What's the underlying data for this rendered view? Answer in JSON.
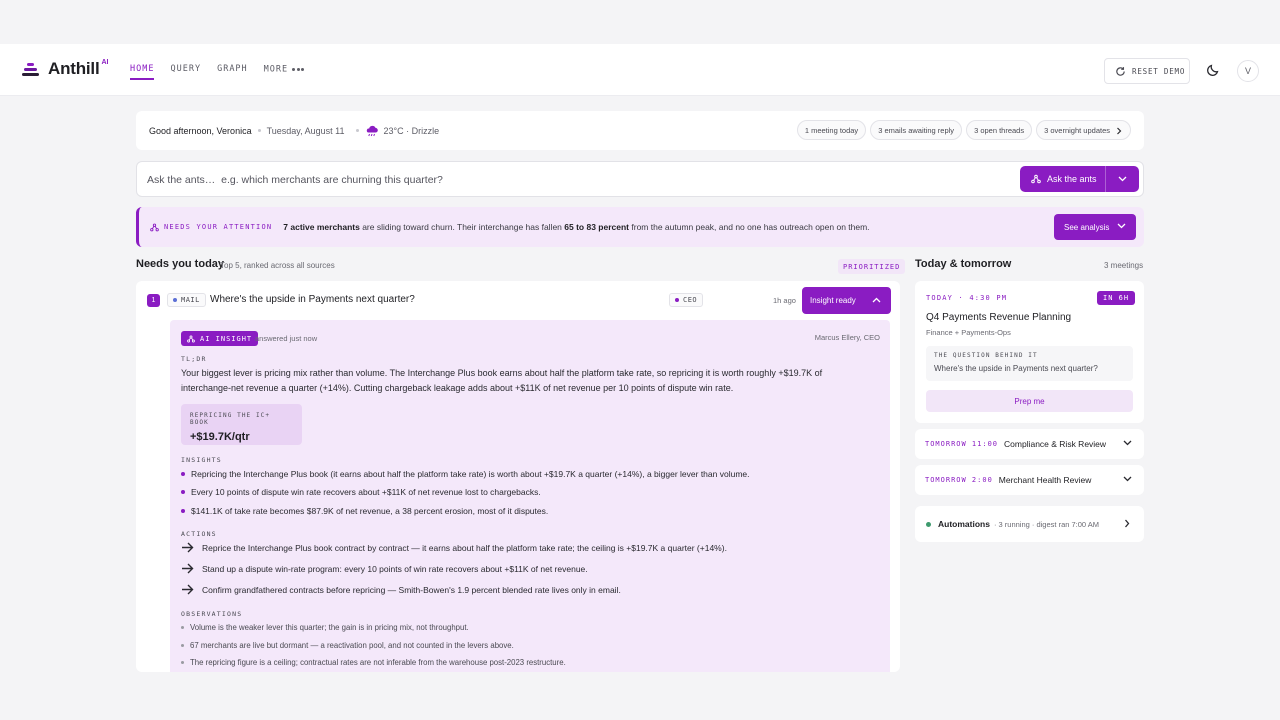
{
  "app": {
    "name": "Anthill",
    "badge": "AI"
  },
  "nav": {
    "items": [
      {
        "label": "HOME",
        "active": true
      },
      {
        "label": "QUERY",
        "active": false
      },
      {
        "label": "GRAPH",
        "active": false
      },
      {
        "label": "MORE",
        "active": false
      }
    ],
    "reset_label": "RESET DEMO",
    "avatar_initial": "V"
  },
  "greeting": {
    "text": "Good afternoon, Veronica",
    "date": "Tuesday, August 11",
    "weather": "23°C · Drizzle",
    "chips": [
      "1 meeting today",
      "3 emails awaiting reply",
      "3 open threads",
      "3 overnight updates"
    ]
  },
  "ask": {
    "placeholder": "Ask the ants…  e.g. which merchants are churning this quarter?",
    "button_label": "Ask the ants"
  },
  "attention": {
    "label": "NEEDS YOUR ATTENTION",
    "bold1": "7 active merchants",
    "text1": " are sliding toward churn. Their interchange has fallen ",
    "bold2": "65 to 83 percent",
    "text2": " from the autumn peak, and no one has outreach open on them.",
    "button_label": "See analysis"
  },
  "needs_today": {
    "title": "Needs you today",
    "subtitle": "Top 5, ranked across all sources",
    "badge": "PRIORITIZED",
    "item": {
      "rank": "1",
      "source": "MAIL",
      "title": "Where's the upside in Payments next quarter?",
      "role": "CEO",
      "ago": "1h ago",
      "button_label": "Insight ready"
    },
    "insight": {
      "badge": "AI INSIGHT",
      "answered": "answered just now",
      "author": "Marcus Ellery, CEO",
      "tldr_label": "TL;DR",
      "tldr": "Your biggest lever is pricing mix rather than volume. The Interchange Plus book earns about half the platform take rate, so repricing it is worth roughly +$19.7K of interchange-net revenue a quarter (+14%). Cutting chargeback leakage adds about +$11K of net revenue per 10 points of dispute win rate.",
      "metric_label": "REPRICING THE IC+ BOOK",
      "metric_value": "+$19.7K/qtr",
      "insights_label": "INSIGHTS",
      "insights": [
        "Repricing the Interchange Plus book (it earns about half the platform take rate) is worth about +$19.7K a quarter (+14%), a bigger lever than volume.",
        "Every 10 points of dispute win rate recovers about +$11K of net revenue lost to chargebacks.",
        "$141.1K of take rate becomes $87.9K of net revenue, a 38 percent erosion, most of it disputes."
      ],
      "actions_label": "ACTIONS",
      "actions": [
        "Reprice the Interchange Plus book contract by contract — it earns about half the platform take rate; the ceiling is +$19.7K a quarter (+14%).",
        "Stand up a dispute win-rate program: every 10 points of win rate recovers about +$11K of net revenue.",
        "Confirm grandfathered contracts before repricing — Smith-Bowen's 1.9 percent blended rate lives only in email."
      ],
      "observations_label": "OBSERVATIONS",
      "observations": [
        "Volume is the weaker lever this quarter; the gain is in pricing mix, not throughput.",
        "67 merchants are live but dormant — a reactivation pool, and not counted in the levers above.",
        "The repricing figure is a ceiling; contractual rates are not inferable from the warehouse post-2023 restructure."
      ]
    }
  },
  "today_tomorrow": {
    "title": "Today & tomorrow",
    "count": "3 meetings",
    "next": {
      "time": "TODAY · 4:30 PM",
      "badge": "IN 6H",
      "title": "Q4 Payments Revenue Planning",
      "attendees": "Finance + Payments-Ops",
      "question_label": "THE QUESTION BEHIND IT",
      "question": "Where's the upside in Payments next quarter?",
      "button_label": "Prep me"
    },
    "later": [
      {
        "time": "TOMORROW 11:00",
        "title": "Compliance & Risk Review"
      },
      {
        "time": "TOMORROW 2:00",
        "title": "Merchant Health Review"
      }
    ],
    "automations": {
      "title": "Automations",
      "detail": "· 3 running · digest ran 7:00 AM"
    }
  },
  "colors": {
    "accent": "#8a1cc2",
    "accent_soft": "#f4e8fa",
    "status_ok": "#3e9a6e"
  }
}
